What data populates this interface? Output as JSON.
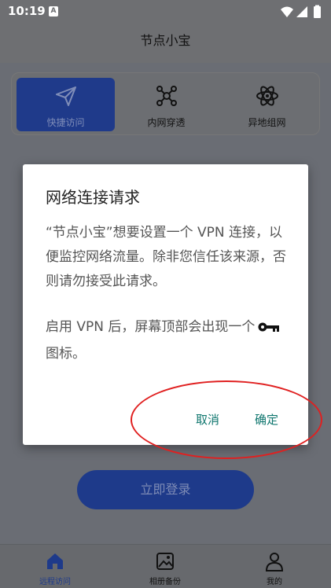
{
  "status_bar": {
    "time": "10:19",
    "notification_letter": "A"
  },
  "app": {
    "title": "节点小宝"
  },
  "features": [
    {
      "label": "快捷访问",
      "active": true,
      "icon": "send-icon"
    },
    {
      "label": "内网穿透",
      "active": false,
      "icon": "network-icon"
    },
    {
      "label": "异地组网",
      "active": false,
      "icon": "atom-icon"
    }
  ],
  "login_button": {
    "label": "立即登录"
  },
  "bottom_nav": [
    {
      "label": "远程访问",
      "active": true,
      "icon": "home-icon"
    },
    {
      "label": "相册备份",
      "active": false,
      "icon": "photo-icon"
    },
    {
      "label": "我的",
      "active": false,
      "icon": "user-icon"
    }
  ],
  "dialog": {
    "title": "网络连接请求",
    "message": "“节点小宝”想要设置一个 VPN 连接，以便监控网络流量。除非您信任该来源，否则请勿接受此请求。",
    "hint_before": "启用 VPN 后，屏幕顶部会出现一个",
    "hint_after": "图标。",
    "cancel_label": "取消",
    "confirm_label": "确定"
  },
  "colors": {
    "accent": "#1e3a8a",
    "dialog_button": "#0f766e",
    "annotation": "#e02020"
  }
}
